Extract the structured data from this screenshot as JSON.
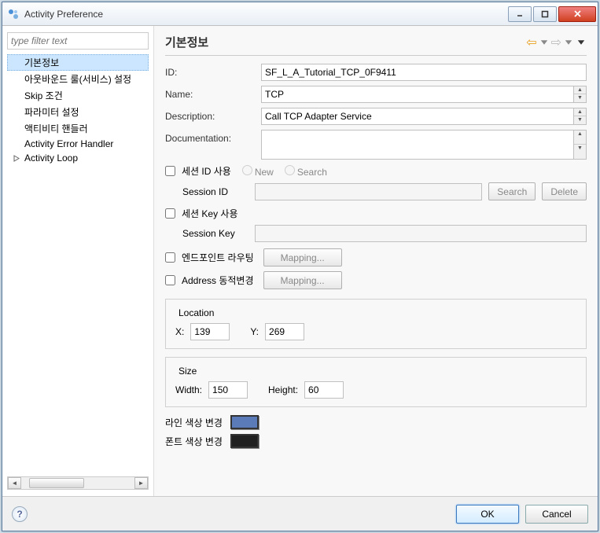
{
  "window": {
    "title": "Activity Preference"
  },
  "filter": {
    "placeholder": "type filter text"
  },
  "tree": {
    "items": [
      {
        "label": "기본정보",
        "selected": true
      },
      {
        "label": "아웃바운드 룰(서비스) 설정"
      },
      {
        "label": "Skip 조건"
      },
      {
        "label": "파라미터 설정"
      },
      {
        "label": "액티비티 핸들러"
      },
      {
        "label": "Activity Error Handler"
      },
      {
        "label": "Activity Loop",
        "expander": true
      }
    ]
  },
  "header": {
    "title": "기본정보"
  },
  "form": {
    "id_label": "ID:",
    "id_value": "SF_L_A_Tutorial_TCP_0F9411",
    "name_label": "Name:",
    "name_value": "TCP",
    "desc_label": "Description:",
    "desc_value": "Call TCP Adapter Service",
    "doc_label": "Documentation:",
    "doc_value": ""
  },
  "session": {
    "use_session_id": "세션 ID 사용",
    "radio_new": "New",
    "radio_search": "Search",
    "session_id_label": "Session ID",
    "search_btn": "Search",
    "delete_btn": "Delete",
    "use_session_key": "세션 Key 사용",
    "session_key_label": "Session Key"
  },
  "routing": {
    "endpoint_label": "엔드포인트 라우팅",
    "address_label": "Address 동적변경",
    "mapping_btn": "Mapping..."
  },
  "location": {
    "legend": "Location",
    "x_label": "X:",
    "x_value": "139",
    "y_label": "Y:",
    "y_value": "269"
  },
  "size": {
    "legend": "Size",
    "w_label": "Width:",
    "w_value": "150",
    "h_label": "Height:",
    "h_value": "60"
  },
  "colors": {
    "line_label": "라인 색상 변경",
    "line_value": "#5a7ab8",
    "font_label": "폰트 색상 변경",
    "font_value": "#202020"
  },
  "footer": {
    "ok": "OK",
    "cancel": "Cancel"
  }
}
